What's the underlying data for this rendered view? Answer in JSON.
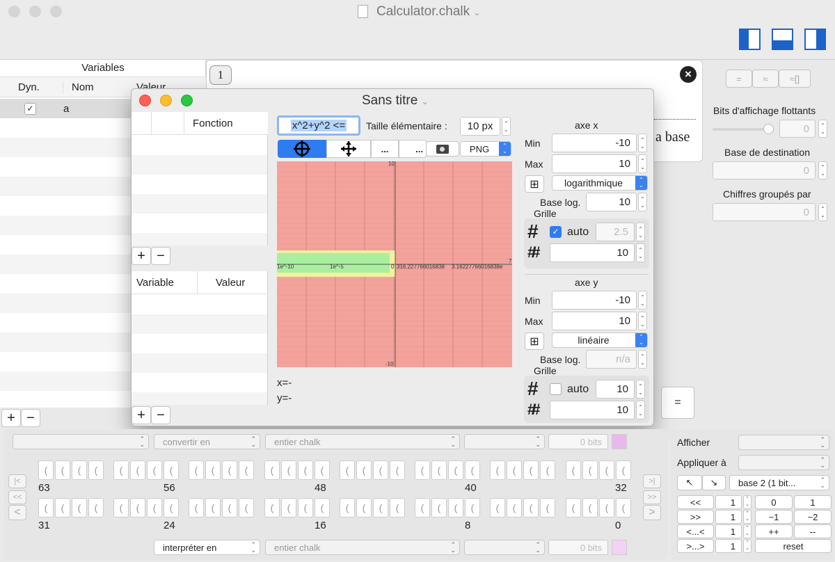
{
  "window": {
    "title": "Calculator.chalk"
  },
  "variables_panel": {
    "title": "Variables",
    "headers": [
      "Dyn.",
      "Nom",
      "Valeur"
    ],
    "rows": [
      {
        "dyn": "✓",
        "name": "a"
      }
    ]
  },
  "result": {
    "index": "1",
    "text_fragment": "a base"
  },
  "right_panel": {
    "mode_buttons": [
      "=",
      "≈",
      "≈[]"
    ],
    "bits_label": "Bits d'affichage flottants",
    "bits_value": "0",
    "dest_base_label": "Base de destination",
    "dest_base_value": "0",
    "group_label": "Chiffres groupés par",
    "group_value": "0",
    "equals": "="
  },
  "graph_window": {
    "title": "Sans titre",
    "functions_header": "Fonction",
    "vars_headers": [
      "Variable",
      "Valeur"
    ],
    "expression": "x^2+y^2 <=",
    "size_label": "Taille élémentaire :",
    "size_value": "10 px",
    "toolbar": {
      "dots1": "...",
      "dots2": "...",
      "export_format": "PNG"
    },
    "readout": {
      "x": "x=-",
      "y": "y=-"
    },
    "axis_x": {
      "title": "axe x",
      "min_label": "Min",
      "min": "-10",
      "max_label": "Max",
      "max": "10",
      "scale": "logarithmique",
      "base_label": "Base log.",
      "base": "10",
      "grid_label": "Grille",
      "auto_label": "auto",
      "auto_checked": "✓",
      "grid_major": "2.5",
      "grid_minor": "10"
    },
    "axis_y": {
      "title": "axe y",
      "min_label": "Min",
      "min": "-10",
      "max_label": "Max",
      "max": "10",
      "scale": "linéaire",
      "base_label": "Base log.",
      "base": "n/a",
      "grid_label": "Grille",
      "auto_label": "auto",
      "grid_major": "10",
      "grid_minor": "10"
    },
    "plot_labels": {
      "top": "10",
      "bottom": "-10",
      "right": "7",
      "x_ticks": [
        "1e^-10",
        "1e^-5",
        "0",
        "316.227766016838",
        "3.16227766016838e"
      ]
    },
    "plot_colors": {
      "background": "#f4a29c",
      "band": "#a9ef9f",
      "band_edge": "#f3f0a0"
    }
  },
  "bottom": {
    "convert_label": "convertir en",
    "int_type": "entier chalk",
    "bits": "0 bits",
    "interpret_label": "interpréter en",
    "int_type2": "entier chalk",
    "bits2": "0 bits",
    "bit_glyph": "(",
    "row1_labels": [
      "63",
      "56",
      "48",
      "40",
      "32"
    ],
    "row2_labels": [
      "31",
      "24",
      "16",
      "8",
      "0"
    ],
    "nav_left": [
      "|<",
      "<<",
      "<"
    ],
    "nav_right": [
      ">|",
      ">>",
      ">"
    ],
    "afficher_label": "Afficher",
    "appliquer_label": "Appliquer à",
    "base_select": "base 2 (1 bit...",
    "arrow_btns": [
      "↖",
      "↘"
    ],
    "ops": [
      {
        "label": "<<",
        "value": "1",
        "b1": "0",
        "b2": "1"
      },
      {
        "label": ">>",
        "value": "1",
        "b1": "~1",
        "b2": "~2"
      },
      {
        "label": "<...<",
        "value": "1",
        "b1": "++",
        "b2": "--"
      },
      {
        "label": ">...>",
        "value": "1",
        "b1": "reset",
        "b2": ""
      }
    ],
    "accent": "#e9b9ee"
  }
}
